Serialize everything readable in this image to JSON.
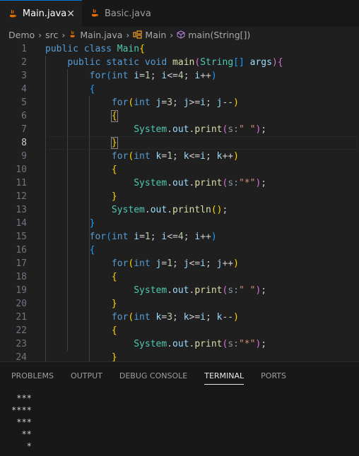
{
  "tabs": [
    {
      "label": "Main.java",
      "active": true
    },
    {
      "label": "Basic.java",
      "active": false
    }
  ],
  "breadcrumb": [
    "Demo",
    "src",
    "Main.java",
    "Main",
    "main(String[])"
  ],
  "panel_tabs": [
    "PROBLEMS",
    "OUTPUT",
    "DEBUG CONSOLE",
    "TERMINAL",
    "PORTS"
  ],
  "active_panel_tab": "TERMINAL",
  "terminal_lines": [
    " ***",
    "****",
    " ***",
    "  **",
    "   *"
  ],
  "code_lines": [
    {
      "n": "1",
      "tokens": [
        [
          "kw",
          "public"
        ],
        [
          "pl",
          " "
        ],
        [
          "kw",
          "class"
        ],
        [
          "pl",
          " "
        ],
        [
          "ty",
          "Main"
        ],
        [
          "b1",
          "{"
        ]
      ]
    },
    {
      "n": "2",
      "tokens": [
        [
          "pl",
          "    "
        ],
        [
          "kw",
          "public"
        ],
        [
          "pl",
          " "
        ],
        [
          "kw",
          "static"
        ],
        [
          "pl",
          " "
        ],
        [
          "kw",
          "void"
        ],
        [
          "pl",
          " "
        ],
        [
          "fn",
          "main"
        ],
        [
          "b2",
          "("
        ],
        [
          "ty",
          "String"
        ],
        [
          "b3",
          "[]"
        ],
        [
          "pl",
          " "
        ],
        [
          "var",
          "args"
        ],
        [
          "b2",
          ")"
        ],
        [
          "b2",
          "{"
        ]
      ]
    },
    {
      "n": "3",
      "tokens": [
        [
          "pl",
          "        "
        ],
        [
          "kw",
          "for"
        ],
        [
          "b3",
          "("
        ],
        [
          "kw",
          "int"
        ],
        [
          "pl",
          " "
        ],
        [
          "var",
          "i"
        ],
        [
          "pl",
          "="
        ],
        [
          "num",
          "1"
        ],
        [
          "pl",
          "; "
        ],
        [
          "var",
          "i"
        ],
        [
          "pl",
          "<="
        ],
        [
          "num",
          "4"
        ],
        [
          "pl",
          "; "
        ],
        [
          "var",
          "i"
        ],
        [
          "pl",
          "++"
        ],
        [
          "b3",
          ")"
        ]
      ]
    },
    {
      "n": "4",
      "tokens": [
        [
          "pl",
          "        "
        ],
        [
          "b3",
          "{"
        ]
      ]
    },
    {
      "n": "5",
      "tokens": [
        [
          "pl",
          "            "
        ],
        [
          "kw",
          "for"
        ],
        [
          "b1",
          "("
        ],
        [
          "kw",
          "int"
        ],
        [
          "pl",
          " "
        ],
        [
          "var",
          "j"
        ],
        [
          "pl",
          "="
        ],
        [
          "num",
          "3"
        ],
        [
          "pl",
          "; "
        ],
        [
          "var",
          "j"
        ],
        [
          "pl",
          ">="
        ],
        [
          "var",
          "i"
        ],
        [
          "pl",
          "; "
        ],
        [
          "var",
          "j"
        ],
        [
          "pl",
          "--"
        ],
        [
          "b1",
          ")"
        ]
      ]
    },
    {
      "n": "6",
      "tokens": [
        [
          "pl",
          "            "
        ],
        [
          "b1h",
          "{"
        ]
      ]
    },
    {
      "n": "7",
      "tokens": [
        [
          "pl",
          "                "
        ],
        [
          "ty",
          "System"
        ],
        [
          "pl",
          "."
        ],
        [
          "var",
          "out"
        ],
        [
          "pl",
          "."
        ],
        [
          "fn",
          "print"
        ],
        [
          "b2",
          "("
        ],
        [
          "hint",
          "s:"
        ],
        [
          "str",
          "\" \""
        ],
        [
          "b2",
          ")"
        ],
        [
          "pl",
          ";"
        ]
      ]
    },
    {
      "n": "8",
      "tokens": [
        [
          "pl",
          "            "
        ],
        [
          "b1h",
          "}"
        ]
      ]
    },
    {
      "n": "9",
      "tokens": [
        [
          "pl",
          "            "
        ],
        [
          "kw",
          "for"
        ],
        [
          "b1",
          "("
        ],
        [
          "kw",
          "int"
        ],
        [
          "pl",
          " "
        ],
        [
          "var",
          "k"
        ],
        [
          "pl",
          "="
        ],
        [
          "num",
          "1"
        ],
        [
          "pl",
          "; "
        ],
        [
          "var",
          "k"
        ],
        [
          "pl",
          "<="
        ],
        [
          "var",
          "i"
        ],
        [
          "pl",
          "; "
        ],
        [
          "var",
          "k"
        ],
        [
          "pl",
          "++"
        ],
        [
          "b1",
          ")"
        ]
      ]
    },
    {
      "n": "10",
      "tokens": [
        [
          "pl",
          "            "
        ],
        [
          "b1",
          "{"
        ]
      ]
    },
    {
      "n": "11",
      "tokens": [
        [
          "pl",
          "                "
        ],
        [
          "ty",
          "System"
        ],
        [
          "pl",
          "."
        ],
        [
          "var",
          "out"
        ],
        [
          "pl",
          "."
        ],
        [
          "fn",
          "print"
        ],
        [
          "b2",
          "("
        ],
        [
          "hint",
          "s:"
        ],
        [
          "str",
          "\"*\""
        ],
        [
          "b2",
          ")"
        ],
        [
          "pl",
          ";"
        ]
      ]
    },
    {
      "n": "12",
      "tokens": [
        [
          "pl",
          "            "
        ],
        [
          "b1",
          "}"
        ]
      ]
    },
    {
      "n": "13",
      "tokens": [
        [
          "pl",
          "            "
        ],
        [
          "ty",
          "System"
        ],
        [
          "pl",
          "."
        ],
        [
          "var",
          "out"
        ],
        [
          "pl",
          "."
        ],
        [
          "fn",
          "println"
        ],
        [
          "b1",
          "()"
        ],
        [
          "pl",
          ";"
        ]
      ]
    },
    {
      "n": "14",
      "tokens": [
        [
          "pl",
          "        "
        ],
        [
          "b3",
          "}"
        ]
      ]
    },
    {
      "n": "15",
      "tokens": [
        [
          "pl",
          "        "
        ],
        [
          "kw",
          "for"
        ],
        [
          "b3",
          "("
        ],
        [
          "kw",
          "int"
        ],
        [
          "pl",
          " "
        ],
        [
          "var",
          "i"
        ],
        [
          "pl",
          "="
        ],
        [
          "num",
          "1"
        ],
        [
          "pl",
          "; "
        ],
        [
          "var",
          "i"
        ],
        [
          "pl",
          "<="
        ],
        [
          "num",
          "4"
        ],
        [
          "pl",
          "; "
        ],
        [
          "var",
          "i"
        ],
        [
          "pl",
          "++"
        ],
        [
          "b3",
          ")"
        ]
      ]
    },
    {
      "n": "16",
      "tokens": [
        [
          "pl",
          "        "
        ],
        [
          "b3",
          "{"
        ]
      ]
    },
    {
      "n": "17",
      "tokens": [
        [
          "pl",
          "            "
        ],
        [
          "kw",
          "for"
        ],
        [
          "b1",
          "("
        ],
        [
          "kw",
          "int"
        ],
        [
          "pl",
          " "
        ],
        [
          "var",
          "j"
        ],
        [
          "pl",
          "="
        ],
        [
          "num",
          "1"
        ],
        [
          "pl",
          "; "
        ],
        [
          "var",
          "j"
        ],
        [
          "pl",
          "<="
        ],
        [
          "var",
          "i"
        ],
        [
          "pl",
          "; "
        ],
        [
          "var",
          "j"
        ],
        [
          "pl",
          "++"
        ],
        [
          "b1",
          ")"
        ]
      ]
    },
    {
      "n": "18",
      "tokens": [
        [
          "pl",
          "            "
        ],
        [
          "b1",
          "{"
        ]
      ]
    },
    {
      "n": "19",
      "tokens": [
        [
          "pl",
          "                "
        ],
        [
          "ty",
          "System"
        ],
        [
          "pl",
          "."
        ],
        [
          "var",
          "out"
        ],
        [
          "pl",
          "."
        ],
        [
          "fn",
          "print"
        ],
        [
          "b2",
          "("
        ],
        [
          "hint",
          "s:"
        ],
        [
          "str",
          "\" \""
        ],
        [
          "b2",
          ")"
        ],
        [
          "pl",
          ";"
        ]
      ]
    },
    {
      "n": "20",
      "tokens": [
        [
          "pl",
          "            "
        ],
        [
          "b1",
          "}"
        ]
      ]
    },
    {
      "n": "21",
      "tokens": [
        [
          "pl",
          "            "
        ],
        [
          "kw",
          "for"
        ],
        [
          "b1",
          "("
        ],
        [
          "kw",
          "int"
        ],
        [
          "pl",
          " "
        ],
        [
          "var",
          "k"
        ],
        [
          "pl",
          "="
        ],
        [
          "num",
          "3"
        ],
        [
          "pl",
          "; "
        ],
        [
          "var",
          "k"
        ],
        [
          "pl",
          ">="
        ],
        [
          "var",
          "i"
        ],
        [
          "pl",
          "; "
        ],
        [
          "var",
          "k"
        ],
        [
          "pl",
          "--"
        ],
        [
          "b1",
          ")"
        ]
      ]
    },
    {
      "n": "22",
      "tokens": [
        [
          "pl",
          "            "
        ],
        [
          "b1",
          "{"
        ]
      ]
    },
    {
      "n": "23",
      "tokens": [
        [
          "pl",
          "                "
        ],
        [
          "ty",
          "System"
        ],
        [
          "pl",
          "."
        ],
        [
          "var",
          "out"
        ],
        [
          "pl",
          "."
        ],
        [
          "fn",
          "print"
        ],
        [
          "b2",
          "("
        ],
        [
          "hint",
          "s:"
        ],
        [
          "str",
          "\"*\""
        ],
        [
          "b2",
          ")"
        ],
        [
          "pl",
          ";"
        ]
      ]
    },
    {
      "n": "24",
      "tokens": [
        [
          "pl",
          "            "
        ],
        [
          "b1",
          "}"
        ]
      ]
    }
  ],
  "current_line": "8",
  "colors": {
    "accent": "#0078d4",
    "java_icon": "#e76f00"
  }
}
